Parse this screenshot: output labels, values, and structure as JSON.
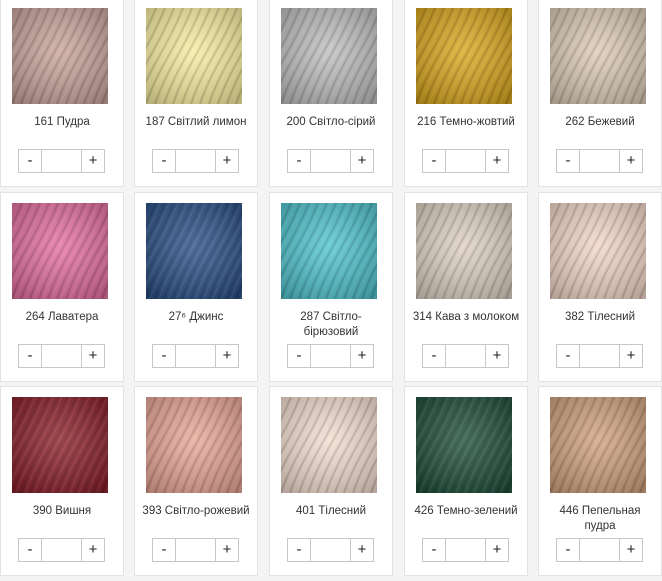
{
  "products": [
    {
      "label": "161 Пудра",
      "color": "#c8a39a",
      "qty": ""
    },
    {
      "label": "187 Світлий лимон",
      "color": "#f6ec9f",
      "qty": ""
    },
    {
      "label": "200 Світло-сірий",
      "color": "#bdbdbd",
      "qty": ""
    },
    {
      "label": "216 Темно-жовтий",
      "color": "#d9a51c",
      "qty": ""
    },
    {
      "label": "262 Бежевий",
      "color": "#dccab5",
      "qty": ""
    },
    {
      "label": "264 Лаватера",
      "color": "#e36da0",
      "qty": ""
    },
    {
      "label": "27⁶ Джинс",
      "color": "#2a4f86",
      "qty": ""
    },
    {
      "label": "287 Світло-бірюзовий",
      "color": "#4fc2cd",
      "qty": ""
    },
    {
      "label": "314 Кава з молоком",
      "color": "#ddcfc1",
      "qty": ""
    },
    {
      "label": "382 Тілесний",
      "color": "#f1d6c7",
      "qty": ""
    },
    {
      "label": "390 Вишня",
      "color": "#8b1f2a",
      "qty": ""
    },
    {
      "label": "393 Світло-рожевий",
      "color": "#e8a595",
      "qty": ""
    },
    {
      "label": "401 Тілесний",
      "color": "#f2dccf",
      "qty": ""
    },
    {
      "label": "426 Темно-зелений",
      "color": "#1f4e3a",
      "qty": ""
    },
    {
      "label": "446 Пепельная пудра",
      "color": "#d0a07d",
      "qty": ""
    }
  ],
  "controls": {
    "minus": "-",
    "plus": "+"
  }
}
